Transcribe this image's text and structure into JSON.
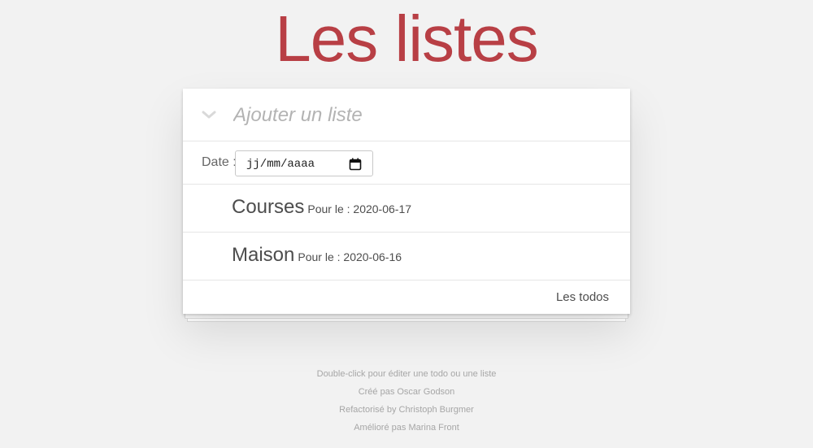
{
  "header": {
    "title": "Les listes"
  },
  "new_list": {
    "placeholder": "Ajouter un liste",
    "toggle_icon": "chevron-down-icon"
  },
  "date_filter": {
    "label": "Date :",
    "value": "jj/mm/aaaa",
    "icon": "calendar-icon"
  },
  "lists": [
    {
      "name": "Courses",
      "date_text": "Pour le : 2020-06-17"
    },
    {
      "name": "Maison",
      "date_text": "Pour le : 2020-06-16"
    }
  ],
  "footer": {
    "todos_link": "Les todos"
  },
  "info": [
    "Double-click pour éditer une todo ou une liste",
    "Créé pas Oscar Godson",
    "Refactorisé by Christoph Burgmer",
    "Amélioré pas Marina Front"
  ],
  "colors": {
    "title": "#b83f45",
    "background": "#f2f2f2"
  }
}
